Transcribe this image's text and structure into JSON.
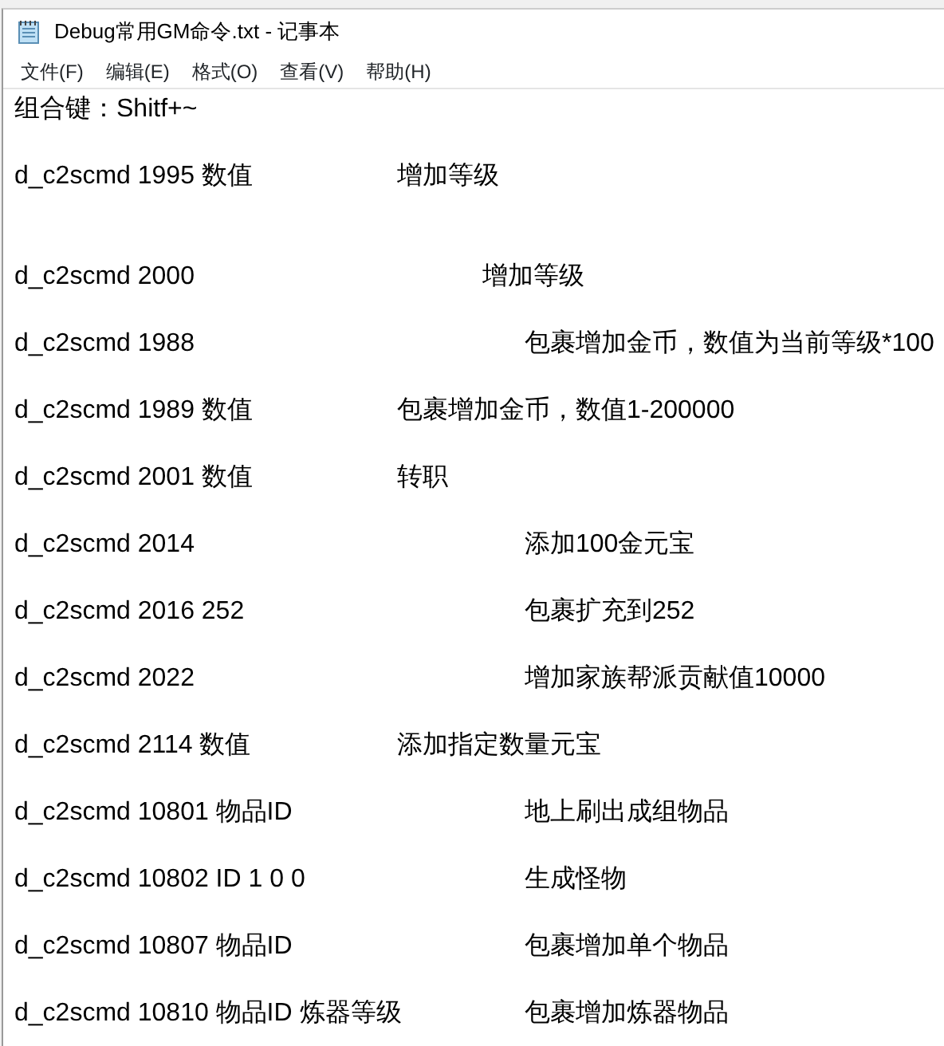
{
  "window": {
    "title": "Debug常用GM命令.txt - 记事本"
  },
  "menu": [
    {
      "label": "文件(F)"
    },
    {
      "label": "编辑(E)"
    },
    {
      "label": "格式(O)"
    },
    {
      "label": "查看(V)"
    },
    {
      "label": "帮助(H)"
    }
  ],
  "lines": [
    {
      "kind": "text",
      "text": "组合键：Shitf+~"
    },
    {
      "kind": "blank"
    },
    {
      "kind": "text",
      "text": "d_c2scmd 1995 数值\t\t增加等级"
    },
    {
      "kind": "blank"
    },
    {
      "kind": "blank"
    },
    {
      "kind": "text",
      "text": "d_c2scmd 2000\t\t            增加等级"
    },
    {
      "kind": "blank"
    },
    {
      "kind": "text",
      "text": "d_c2scmd 1988\t\t\t包裹增加金币，数值为当前等级*100"
    },
    {
      "kind": "blank"
    },
    {
      "kind": "text",
      "text": "d_c2scmd 1989 数值\t\t包裹增加金币，数值1-200000"
    },
    {
      "kind": "blank"
    },
    {
      "kind": "text",
      "text": "d_c2scmd 2001 数值\t\t转职"
    },
    {
      "kind": "blank"
    },
    {
      "kind": "text",
      "text": "d_c2scmd 2014\t\t\t添加100金元宝"
    },
    {
      "kind": "blank"
    },
    {
      "kind": "text",
      "text": "d_c2scmd 2016 252\t\t\t包裹扩充到252"
    },
    {
      "kind": "blank"
    },
    {
      "kind": "text",
      "text": "d_c2scmd 2022\t\t\t增加家族帮派贡献值10000"
    },
    {
      "kind": "blank"
    },
    {
      "kind": "text",
      "text": "d_c2scmd 2114 数值\t\t添加指定数量元宝"
    },
    {
      "kind": "blank"
    },
    {
      "kind": "text",
      "text": "d_c2scmd 10801 物品ID\t\t地上刷出成组物品"
    },
    {
      "kind": "blank"
    },
    {
      "kind": "text",
      "text": "d_c2scmd 10802 ID 1 0 0\t\t生成怪物"
    },
    {
      "kind": "blank"
    },
    {
      "kind": "text",
      "text": "d_c2scmd 10807 物品ID\t\t包裹增加单个物品"
    },
    {
      "kind": "blank"
    },
    {
      "kind": "text",
      "text": "d_c2scmd 10810 物品ID 炼器等级\t包裹增加炼器物品"
    }
  ]
}
